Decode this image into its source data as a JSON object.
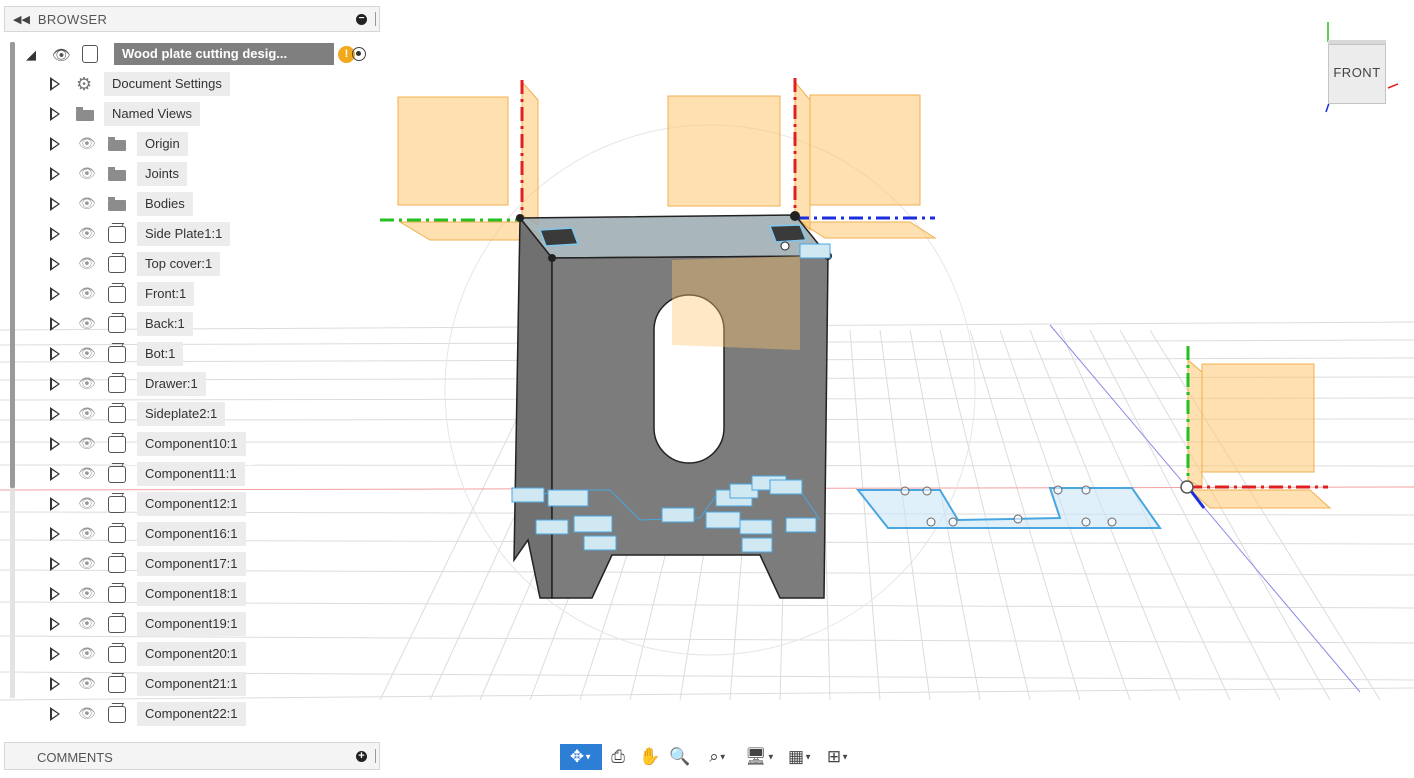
{
  "browser": {
    "title": "BROWSER",
    "collapse_icon": "double-chevron-left-icon",
    "root": {
      "label": "Wood plate cutting desig...",
      "warning": "!"
    },
    "items": [
      {
        "label": "Document Settings",
        "icon": "gear-icon",
        "eye": false
      },
      {
        "label": "Named Views",
        "icon": "folder-icon",
        "eye": false
      },
      {
        "label": "Origin",
        "icon": "folder-icon",
        "eye": true
      },
      {
        "label": "Joints",
        "icon": "folder-icon",
        "eye": true
      },
      {
        "label": "Bodies",
        "icon": "folder-icon",
        "eye": true
      },
      {
        "label": "Side Plate1:1",
        "icon": "component-icon",
        "eye": true
      },
      {
        "label": "Top cover:1",
        "icon": "component-icon",
        "eye": true
      },
      {
        "label": "Front:1",
        "icon": "component-icon",
        "eye": true
      },
      {
        "label": "Back:1",
        "icon": "component-icon",
        "eye": true
      },
      {
        "label": "Bot:1",
        "icon": "component-icon",
        "eye": true
      },
      {
        "label": "Drawer:1",
        "icon": "component-icon",
        "eye": true
      },
      {
        "label": "Sideplate2:1",
        "icon": "component-icon",
        "eye": true
      },
      {
        "label": "Component10:1",
        "icon": "component-icon",
        "eye": true
      },
      {
        "label": "Component11:1",
        "icon": "component-icon",
        "eye": true
      },
      {
        "label": "Component12:1",
        "icon": "component-icon",
        "eye": true
      },
      {
        "label": "Component16:1",
        "icon": "component-icon",
        "eye": true
      },
      {
        "label": "Component17:1",
        "icon": "component-icon",
        "eye": true
      },
      {
        "label": "Component18:1",
        "icon": "component-icon",
        "eye": true
      },
      {
        "label": "Component19:1",
        "icon": "component-icon",
        "eye": true
      },
      {
        "label": "Component20:1",
        "icon": "component-icon",
        "eye": true
      },
      {
        "label": "Component21:1",
        "icon": "component-icon",
        "eye": true
      },
      {
        "label": "Component22:1",
        "icon": "component-icon",
        "eye": true
      }
    ]
  },
  "comments": {
    "title": "COMMENTS"
  },
  "viewcube": {
    "face_label": "FRONT"
  },
  "colors": {
    "x_axis": "#e02020",
    "y_axis": "#22c022",
    "z_axis": "#1a2ee0",
    "plane": "#ffc670",
    "sketch": "#4aa6e0",
    "body": "#6e6e6e",
    "active_tool": "#2d7fd5"
  },
  "toolbar": {
    "tools": [
      "orbit-icon",
      "look-at-icon",
      "pan-icon",
      "zoom-icon",
      "fit-icon",
      "display-settings-icon",
      "grid-settings-icon",
      "viewports-icon"
    ]
  }
}
